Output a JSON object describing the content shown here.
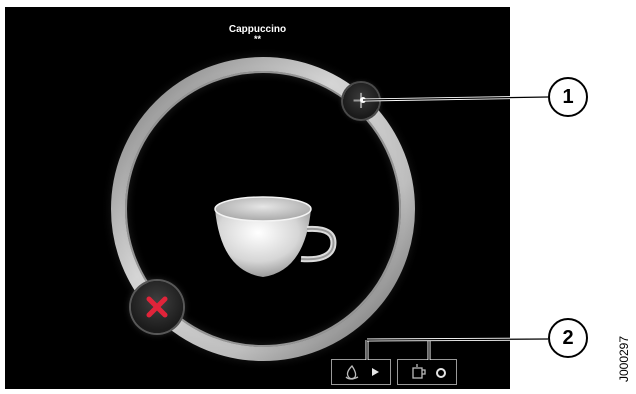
{
  "drink": {
    "name": "Cappuccino",
    "strength": "**"
  },
  "controls": {
    "increase_symbol": "+",
    "cancel_icon": "close-x-icon"
  },
  "status_bar": {
    "left_icons": [
      "coffee-bean-drop-icon",
      "play-arrow-icon"
    ],
    "right_icons": [
      "cup-dispense-icon",
      "ring-icon"
    ]
  },
  "callouts": {
    "one": "1",
    "two": "2"
  },
  "figure_number": "J000297",
  "colors": {
    "screen_background": "#000000",
    "ring": "#d8d8d8",
    "cancel_x": "#e0243a",
    "callout_line": "#ffffff"
  }
}
